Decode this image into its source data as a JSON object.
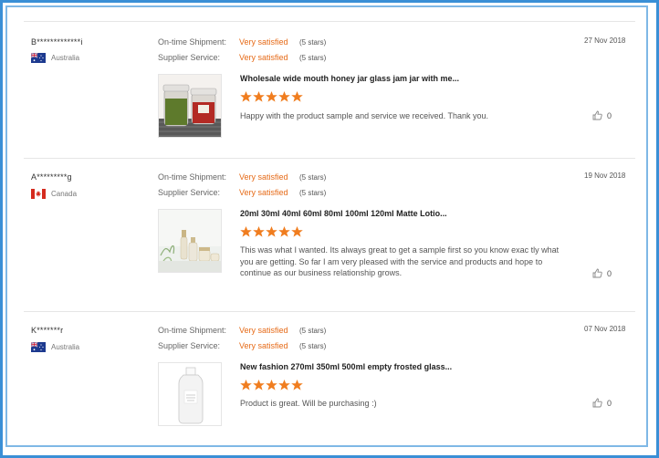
{
  "labels": {
    "ontime": "On-time Shipment:",
    "supplier": "Supplier Service:"
  },
  "reviews": [
    {
      "buyer": "B*************i",
      "country": "Australia",
      "flag": "australia-flag-icon",
      "ontime_rating": "Very satisfied",
      "ontime_stars": "(5 stars)",
      "supplier_rating": "Very satisfied",
      "supplier_stars": "(5 stars)",
      "date": "27 Nov 2018",
      "product": "Wholesale wide mouth honey jar glass jam jar with me...",
      "stars": 5,
      "comment": "Happy with the product sample and service we received. Thank you.",
      "likes": "0"
    },
    {
      "buyer": "A*********g",
      "country": "Canada",
      "flag": "canada-flag-icon",
      "ontime_rating": "Very satisfied",
      "ontime_stars": "(5 stars)",
      "supplier_rating": "Very satisfied",
      "supplier_stars": "(5 stars)",
      "date": "19 Nov 2018",
      "product": "20ml 30ml 40ml 60ml 80ml 100ml 120ml Matte Lotio...",
      "stars": 5,
      "comment": "This was what I wanted. Its always great to get a sample first so you know exac tly what you are getting.  So far I am very pleased with the service and products and hope to continue as our business relationship grows.",
      "likes": "0"
    },
    {
      "buyer": "K*******r",
      "country": "Australia",
      "flag": "australia-flag-icon",
      "ontime_rating": "Very satisfied",
      "ontime_stars": "(5 stars)",
      "supplier_rating": "Very satisfied",
      "supplier_stars": "(5 stars)",
      "date": "07 Nov 2018",
      "product": "New fashion 270ml 350ml 500ml empty frosted glass...",
      "stars": 5,
      "comment": "Product is great. Will be purchasing :)",
      "likes": "0"
    }
  ],
  "colors": {
    "accent": "#e66a17",
    "star": "#f07d1f",
    "frame": "#3a8fd6"
  }
}
